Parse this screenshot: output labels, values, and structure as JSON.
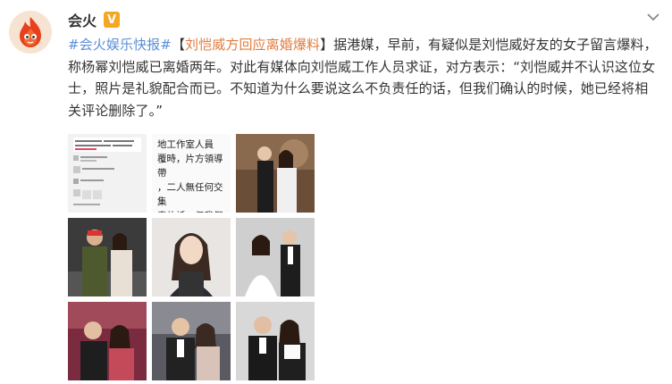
{
  "post": {
    "username": "会火",
    "verified_badge": "V",
    "tag": "#会火娱乐快报#",
    "bracket_open": "【",
    "headline": "刘恺威方回应离婚爆料",
    "bracket_close": "】",
    "body": "据港媒，早前，有疑似是刘恺威好友的女子留言爆料，称杨幂刘恺威已离婚两年。对此有媒体向刘恺威工作人员求证，对方表示：“刘恺威并不认识这位女士，照片是礼貌配合而已。不知道为什么要说这么不负责任的话，但我们确认的时候，她已经将相关评论删除了。”",
    "photo_2_caption": "地工作室人員\n覆時，片方領導帶\n，二人無任何交集\n責的話，但我們確\n心處吧。"
  },
  "icons": {
    "avatar": "fire-mascot-icon",
    "menu": "chevron-down-icon"
  },
  "colors": {
    "tag": "#5b8fd6",
    "headline": "#e27b3c",
    "verified": "#f5a623"
  }
}
